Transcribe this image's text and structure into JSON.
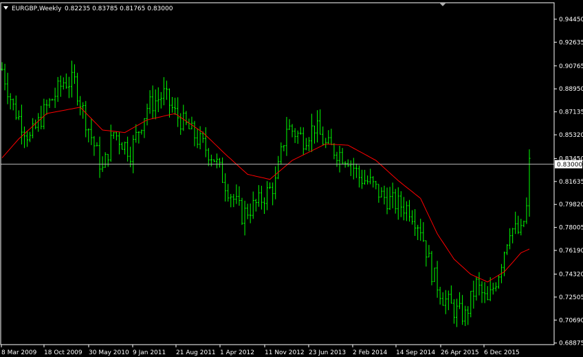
{
  "header": {
    "symbol_timeframe": "EURGBP,Weekly",
    "ohlc": "0.82235 0.83785 0.81765 0.83000"
  },
  "colors": {
    "background": "#000000",
    "bars": "#00ff00",
    "moving_average": "#ff0000",
    "axis": "#ffffff",
    "current_price_line": "#c0c0c0"
  },
  "icons": {
    "menu": "triangle-down-icon",
    "scroll_marker": "triangle-down-icon"
  },
  "chart_data": {
    "type": "ohlc",
    "title": "EURGBP,Weekly",
    "current_price": 0.83,
    "price_ticks": [
      0.9445,
      0.92635,
      0.90765,
      0.8895,
      0.87135,
      0.8532,
      0.8345,
      0.81635,
      0.7982,
      0.78005,
      0.7619,
      0.7432,
      0.72505,
      0.7069,
      0.68875
    ],
    "time_ticks": [
      "8 Mar 2009",
      "18 Oct 2009",
      "30 May 2010",
      "9 Jan 2011",
      "21 Aug 2011",
      "1 Apr 2012",
      "11 Nov 2012",
      "23 Jun 2013",
      "2 Feb 2014",
      "14 Sep 2014",
      "26 Apr 2015",
      "6 Dec 2015"
    ],
    "ylim": [
      0.6875,
      0.9575
    ],
    "bar_count": 190,
    "price_path": [
      [
        0,
        0.905
      ],
      [
        4,
        0.875
      ],
      [
        10,
        0.85
      ],
      [
        16,
        0.875
      ],
      [
        22,
        0.895
      ],
      [
        26,
        0.895
      ],
      [
        30,
        0.865
      ],
      [
        36,
        0.825
      ],
      [
        40,
        0.855
      ],
      [
        46,
        0.84
      ],
      [
        52,
        0.875
      ],
      [
        58,
        0.885
      ],
      [
        62,
        0.87
      ],
      [
        70,
        0.85
      ],
      [
        76,
        0.835
      ],
      [
        80,
        0.815
      ],
      [
        86,
        0.79
      ],
      [
        92,
        0.8
      ],
      [
        98,
        0.815
      ],
      [
        102,
        0.86
      ],
      [
        108,
        0.85
      ],
      [
        112,
        0.86
      ],
      [
        116,
        0.845
      ],
      [
        120,
        0.84
      ],
      [
        124,
        0.835
      ],
      [
        128,
        0.82
      ],
      [
        132,
        0.815
      ],
      [
        136,
        0.805
      ],
      [
        140,
        0.8
      ],
      [
        146,
        0.795
      ],
      [
        150,
        0.78
      ],
      [
        154,
        0.745
      ],
      [
        158,
        0.725
      ],
      [
        162,
        0.715
      ],
      [
        166,
        0.71
      ],
      [
        170,
        0.735
      ],
      [
        174,
        0.72
      ],
      [
        178,
        0.745
      ],
      [
        182,
        0.78
      ],
      [
        186,
        0.775
      ],
      [
        188,
        0.795
      ],
      [
        189,
        0.83
      ]
    ],
    "ma_path": [
      [
        0,
        0.835
      ],
      [
        6,
        0.85
      ],
      [
        16,
        0.87
      ],
      [
        28,
        0.875
      ],
      [
        36,
        0.857
      ],
      [
        44,
        0.855
      ],
      [
        52,
        0.865
      ],
      [
        62,
        0.87
      ],
      [
        72,
        0.855
      ],
      [
        80,
        0.838
      ],
      [
        88,
        0.822
      ],
      [
        96,
        0.818
      ],
      [
        104,
        0.833
      ],
      [
        116,
        0.846
      ],
      [
        124,
        0.845
      ],
      [
        134,
        0.833
      ],
      [
        142,
        0.817
      ],
      [
        150,
        0.803
      ],
      [
        156,
        0.775
      ],
      [
        162,
        0.755
      ],
      [
        168,
        0.743
      ],
      [
        174,
        0.737
      ],
      [
        180,
        0.745
      ],
      [
        186,
        0.76
      ],
      [
        189,
        0.763
      ]
    ]
  }
}
